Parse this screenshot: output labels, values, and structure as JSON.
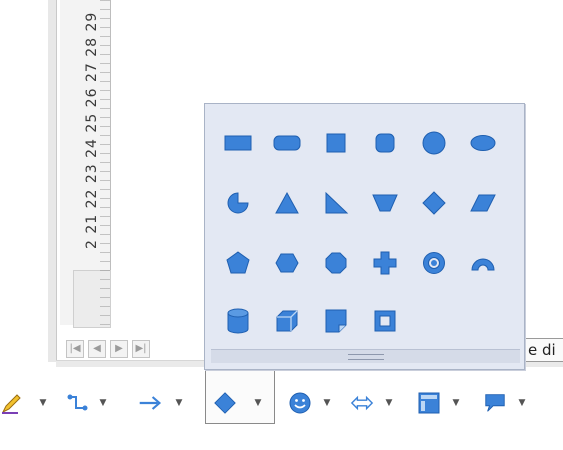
{
  "ruler": {
    "labels": "2 21 22 23 24 25 26 27 28 29"
  },
  "sheet_nav": [
    "|◀",
    "◀",
    "▶",
    "▶|"
  ],
  "cut_off_text": "e di",
  "palette": {
    "shapes": [
      [
        "rectangle",
        "rounded-rectangle",
        "square",
        "rounded-square",
        "circle",
        "ellipse"
      ],
      [
        "circle-pie",
        "isosceles-triangle",
        "right-triangle",
        "trapezoid",
        "diamond",
        "parallelogram"
      ],
      [
        "pentagon",
        "hexagon",
        "octagon",
        "cross",
        "ring",
        "block-arc"
      ],
      [
        "cylinder",
        "cube",
        "folded-corner",
        "frame"
      ]
    ]
  },
  "toolbar": {
    "items": [
      "lines-and-arrows",
      "connectors",
      "arrow",
      "basic-shapes",
      "symbol-shapes",
      "block-arrows",
      "flowcharts",
      "callouts"
    ]
  },
  "colors": {
    "shape_fill": "#3b82d8",
    "shape_stroke": "#1f5fb0",
    "palette_bg": "#e3e8f3"
  }
}
